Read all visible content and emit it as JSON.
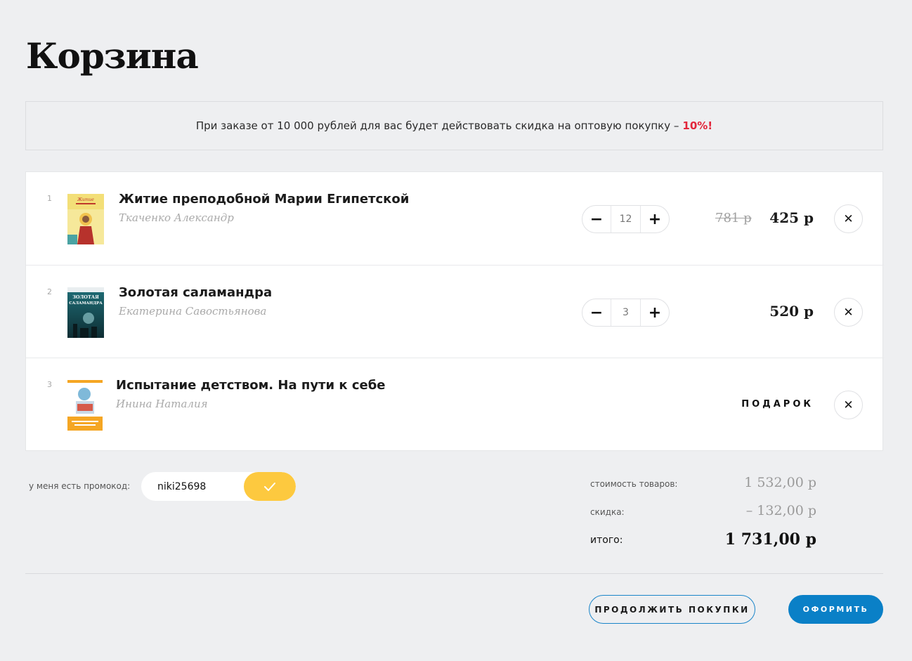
{
  "page": {
    "title": "Корзина"
  },
  "banner": {
    "text": "При заказе от 10 000 рублей для вас будет действовать скидка на оптовую покупку –",
    "accent": "10%!"
  },
  "items": [
    {
      "index": "1",
      "title": "Житие преподобной Марии Египетской",
      "author": "Ткаченко Александр",
      "quantity": "12",
      "old_price": "781 р",
      "price": "425 р"
    },
    {
      "index": "2",
      "title": "Золотая саламандра",
      "author": "Екатерина Савостьянова",
      "quantity": "3",
      "price": "520 р"
    },
    {
      "index": "3",
      "title": "Испытание детством. На пути к себе",
      "author": "Инина Наталия",
      "gift_label": "ПОДАРОК"
    }
  ],
  "controls": {
    "minus": "−",
    "plus": "+",
    "remove": "✕"
  },
  "promo": {
    "label": "у меня есть промокод:",
    "value": "niki25698"
  },
  "summary": {
    "subtotal_label": "стоимость товаров:",
    "subtotal": "1 532,00 р",
    "discount_label": "скидка:",
    "discount": "– 132,00 р",
    "total_label": "итого:",
    "total": "1 731,00 р"
  },
  "actions": {
    "continue": "ПРОДОЛЖИТЬ ПОКУПКИ",
    "checkout": "ОФОРМИТЬ"
  },
  "colors": {
    "accent_red": "#e2253a",
    "promo_yellow": "#fdc93f",
    "primary_blue": "#0a80c7",
    "background": "#eeeff1"
  }
}
